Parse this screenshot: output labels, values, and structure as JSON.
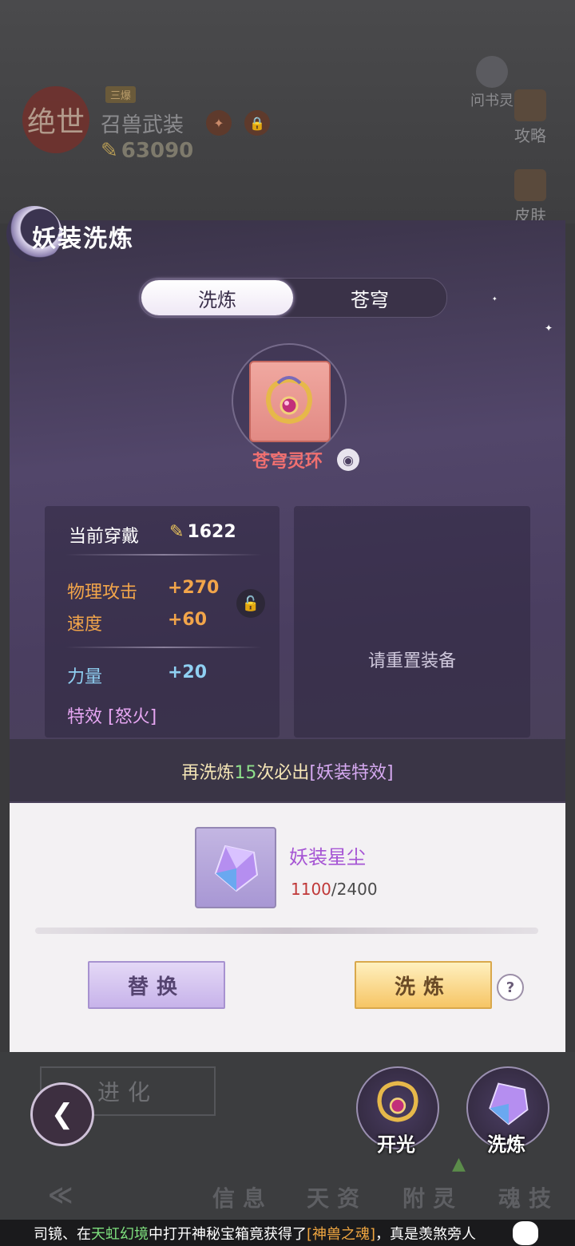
{
  "header": {
    "seal_text": "绝世",
    "tag": "三爆",
    "weapon_name": "召兽武装",
    "power": "63090",
    "side_buttons": [
      "攻略",
      "皮肤"
    ],
    "helper_label": "问书灵"
  },
  "panel": {
    "title": "妖装洗炼",
    "tabs": [
      {
        "label": "洗炼",
        "active": true
      },
      {
        "label": "苍穹",
        "active": false
      }
    ],
    "item": {
      "name": "苍穹灵环",
      "rarity_color": "#f07070"
    },
    "current": {
      "label": "当前穿戴",
      "power": "1622",
      "stats": [
        {
          "name": "物理攻击",
          "value": "+270",
          "color": "#f2a54a"
        },
        {
          "name": "速度",
          "value": "+60",
          "color": "#f2a54a"
        },
        {
          "name": "力量",
          "value": "+20",
          "color": "#8fd0f2"
        }
      ],
      "special": "特效 [怒火]"
    },
    "reset_hint": "请重置装备",
    "guarantee": {
      "prefix": "再洗炼",
      "count": "15",
      "suffix": "次必出",
      "bracket": "[妖装特效]"
    }
  },
  "material": {
    "name": "妖装星尘",
    "have": "1100",
    "need": "/2400"
  },
  "buttons": {
    "replace": "替换",
    "wash": "洗炼",
    "help": "?"
  },
  "bottom": {
    "evolve": "进化",
    "round_buttons": [
      {
        "label": "开光"
      },
      {
        "label": "洗炼"
      }
    ],
    "nav": [
      "信息",
      "天资",
      "附灵",
      "魂技"
    ]
  },
  "ticker": {
    "a": "司镜、在",
    "b": "天虹幻境",
    "c": "中打开神秘宝箱竟获得了",
    "d": "[神兽之魂]",
    "e": "，真是羡煞旁人"
  },
  "colors": {
    "accent_gold": "#f6c565",
    "accent_purple": "#c7b3ea",
    "panel_bg": "#4a3e60"
  }
}
